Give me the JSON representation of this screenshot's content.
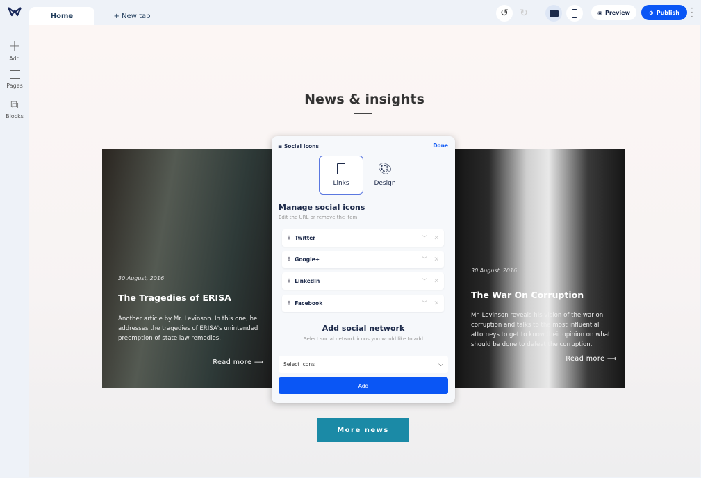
{
  "app": {
    "tabs": [
      {
        "label": "Home"
      },
      {
        "label": "+ New tab"
      }
    ]
  },
  "sidebar": {
    "items": [
      {
        "label": "Add",
        "icon": "plus-icon"
      },
      {
        "label": "Pages",
        "icon": "menu-icon"
      },
      {
        "label": "Blocks",
        "icon": "puzzle-icon"
      }
    ]
  },
  "toolbar": {
    "preview": "Preview",
    "publish": "Publish",
    "accent": "#0a56f5"
  },
  "page": {
    "title": "News & insights",
    "more_news": "More news",
    "cards": [
      {
        "date": "30 August, 2016",
        "title": "The Tragedies of ERISA",
        "text": "Another article by Mr. Levinson. In this one, he addresses the tragedies of ERISA's unintended preemption of state law remedies.",
        "read_more": "Read more ⟶"
      },
      {
        "date": "30 August, 2016",
        "title": "The War On Corruption",
        "text": "Mr. Levinson reveals his vision of the war on corruption and talks to the most influential attorneys to get to know their opinion on what should be done to defeat the corruption.",
        "read_more": "Read more ⟶"
      }
    ]
  },
  "panel": {
    "title": "Social Icons",
    "done": "Done",
    "tabs": [
      {
        "label": "Links"
      },
      {
        "label": "Design"
      }
    ],
    "manage_title": "Manage social icons",
    "manage_sub": "Edit the URL or remove the item",
    "items": [
      {
        "label": "Twitter"
      },
      {
        "label": "Google+"
      },
      {
        "label": "LinkedIn"
      },
      {
        "label": "Facebook"
      }
    ],
    "add_title": "Add social network",
    "add_sub": "Select social network icons you would like to add",
    "select_placeholder": "Select icons",
    "add_button": "Add"
  }
}
